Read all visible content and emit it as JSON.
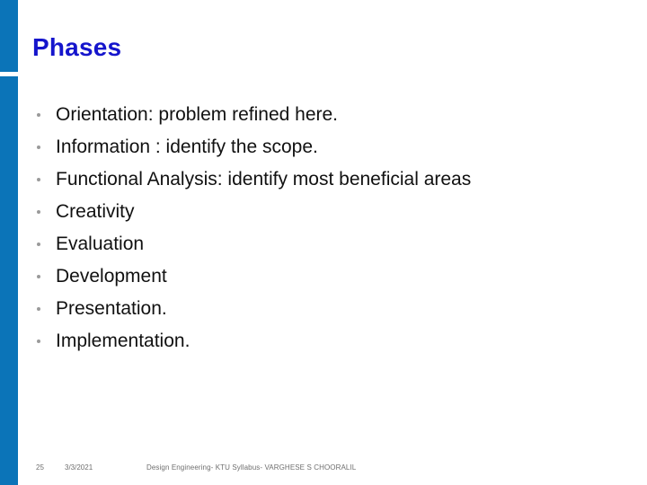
{
  "slide": {
    "title": "Phases",
    "accent_color": "#0B74B8",
    "title_color": "#1515CC",
    "background_color": "#ffffff",
    "bullet_color": "#9a9a9a",
    "body_text_color": "#111111"
  },
  "bullets": [
    {
      "text": "Orientation: problem refined here."
    },
    {
      "text": "Information : identify the scope."
    },
    {
      "text": "Functional Analysis: identify most beneficial areas"
    },
    {
      "text": "Creativity"
    },
    {
      "text": "Evaluation"
    },
    {
      "text": "Development"
    },
    {
      "text": "Presentation."
    },
    {
      "text": "Implementation."
    }
  ],
  "footer": {
    "slide_number": "25",
    "date": "3/3/2021",
    "note": "Design Engineering- KTU Syllabus- VARGHESE S CHOORALIL"
  }
}
